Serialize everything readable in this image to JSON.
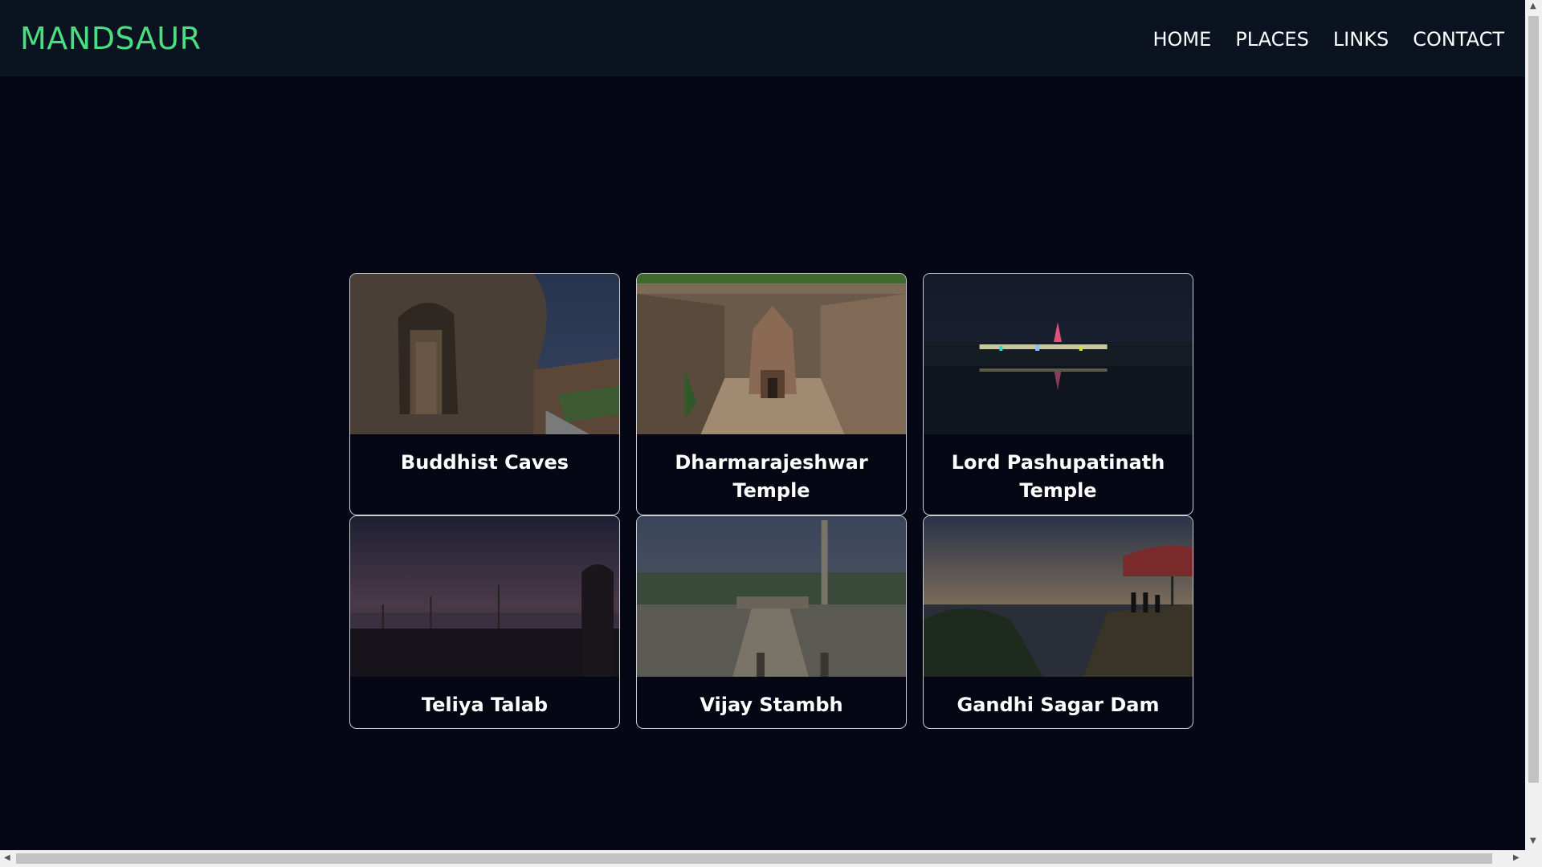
{
  "header": {
    "brand": "MANDSAUR",
    "nav": [
      {
        "label": "HOME"
      },
      {
        "label": "PLACES"
      },
      {
        "label": "LINKS"
      },
      {
        "label": "CONTACT"
      }
    ]
  },
  "places": [
    {
      "title": "Buddhist Caves"
    },
    {
      "title": "Dharmarajeshwar Temple"
    },
    {
      "title": "Lord Pashupatinath Temple"
    },
    {
      "title": "Teliya Talab"
    },
    {
      "title": "Vijay Stambh"
    },
    {
      "title": "Gandhi Sagar Dam"
    }
  ],
  "colors": {
    "brand": "#4ade80",
    "background": "#050814",
    "navbar": "#0b1220",
    "card_border": "#c9ccd3"
  }
}
